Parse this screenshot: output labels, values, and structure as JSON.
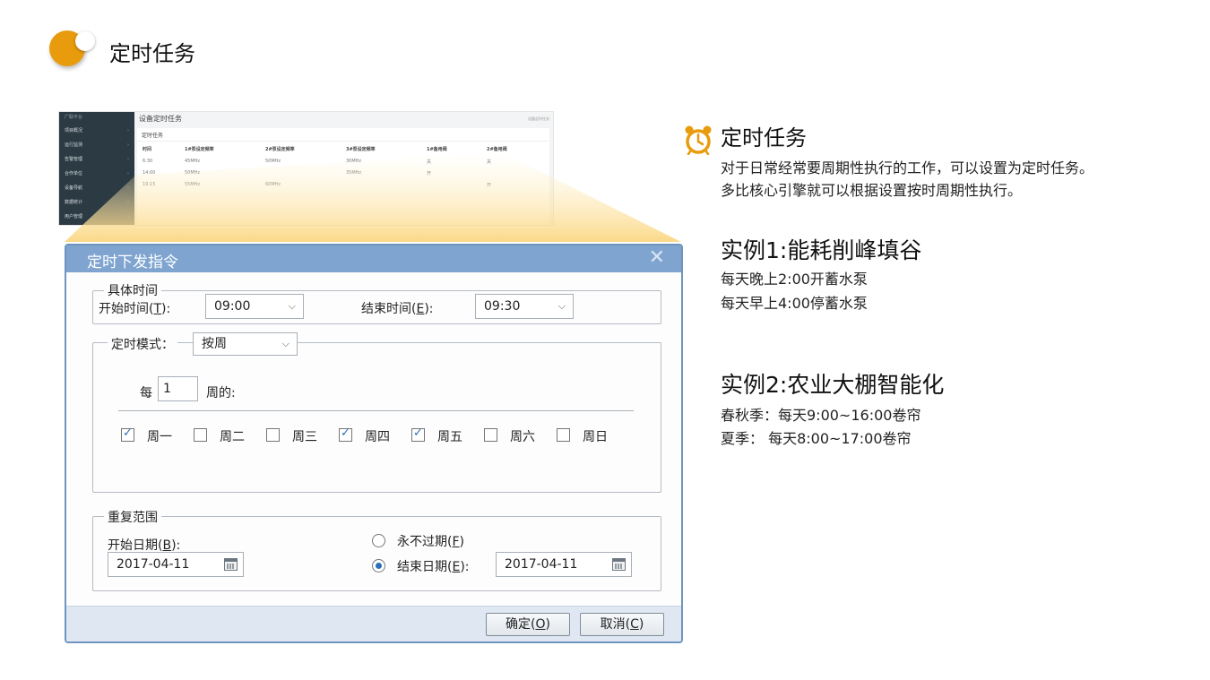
{
  "slide": {
    "title": "定时任务"
  },
  "mini_screenshot": {
    "brand": "广联平台",
    "nav": [
      "项目概况",
      "运行监测",
      "告警管理",
      "合作单位",
      "设备导航",
      "数据统计",
      "用户管理"
    ],
    "page_title": "设备定时任务",
    "breadcrumb": "设备定时任务",
    "card_title": "定时任务",
    "table": {
      "headers": [
        "时间",
        "1#泵设定频率",
        "2#泵设定频率",
        "3#泵设定频率",
        "1#备用阀",
        "2#备用阀"
      ],
      "rows": [
        [
          "6:30",
          "45MHz",
          "50MHz",
          "30MHz",
          "关",
          "关"
        ],
        [
          "14:00",
          "50MHz",
          "",
          "35MHz",
          "开",
          ""
        ],
        [
          "19:15",
          "55MHz",
          "60MHz",
          "",
          "",
          "开"
        ]
      ]
    }
  },
  "dialog": {
    "title": "定时下发指令",
    "close_glyph": "✕",
    "specific_time": {
      "legend": "具体时间",
      "start_label": "开始时间(",
      "start_hotkey": "T",
      "start_suffix": "):",
      "start_value": "09:00",
      "end_label": "结束时间(",
      "end_hotkey": "E",
      "end_suffix": "):",
      "end_value": "09:30"
    },
    "mode": {
      "label": "定时模式：",
      "value": "按周",
      "every_prefix": "每",
      "every_value": "1",
      "every_suffix": "周的:",
      "days": [
        {
          "label": "周一",
          "checked": true
        },
        {
          "label": "周二",
          "checked": false
        },
        {
          "label": "周三",
          "checked": false
        },
        {
          "label": "周四",
          "checked": true
        },
        {
          "label": "周五",
          "checked": true
        },
        {
          "label": "周六",
          "checked": false
        },
        {
          "label": "周日",
          "checked": false
        }
      ]
    },
    "repeat": {
      "legend": "重复范围",
      "start_date_label": "开始日期(",
      "start_date_hotkey": "B",
      "start_date_suffix": "):",
      "start_date_value": "2017-04-11",
      "never_label": "永不过期(",
      "never_hotkey": "F",
      "never_suffix": ")",
      "never_selected": false,
      "end_date_label": "结束日期(",
      "end_date_hotkey": "E",
      "end_date_suffix": "):",
      "end_date_selected": true,
      "end_date_value": "2017-04-11"
    },
    "ok_label": "确定(",
    "ok_hotkey": "O",
    "ok_suffix": ")",
    "cancel_label": "取消(",
    "cancel_hotkey": "C",
    "cancel_suffix": ")"
  },
  "right": {
    "heading": "定时任务",
    "desc_line1": "对于日常经常要周期性执行的工作，可以设置为定时任务。",
    "desc_line2": "多比核心引擎就可以根据设置按时周期性执行。",
    "example1_title": "实例1:能耗削峰填谷",
    "example1_line1": "每天晚上2:00开蓄水泵",
    "example1_line2": "每天早上4:00停蓄水泵",
    "example2_title": "实例2:农业大棚智能化",
    "example2_line1": "春秋季：每天9:00~16:00卷帘",
    "example2_line2": "夏季： 每天8:00~17:00卷帘"
  },
  "colors": {
    "accent_orange": "#e89b0c",
    "dialog_title_bar": "#7ea4cf",
    "checkbox_blue": "#2c6fb8"
  }
}
